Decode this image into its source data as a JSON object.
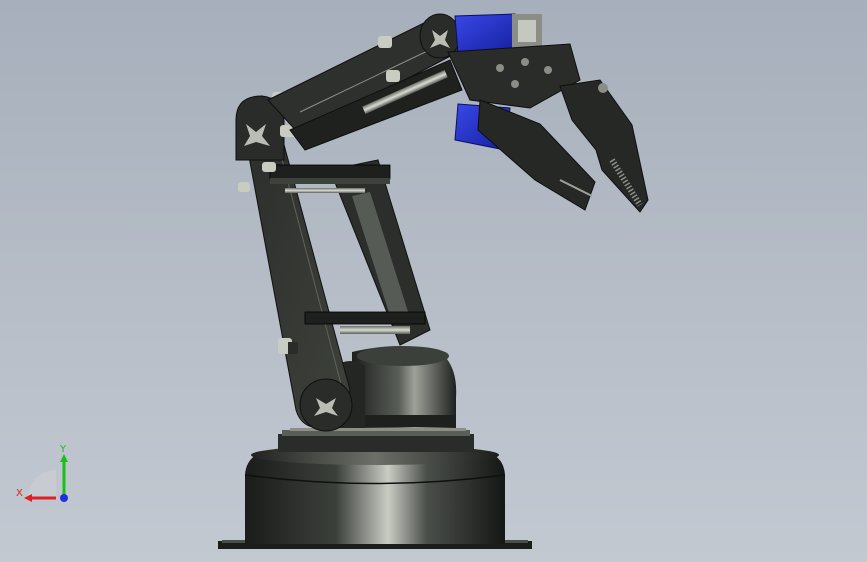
{
  "viewport": {
    "background_top": "#a6afbb",
    "background_bottom": "#c3c9d1"
  },
  "colors": {
    "metal_dark": "#1e201e",
    "metal_mid": "#3a3d39",
    "metal_light": "#6f746c",
    "servo_blue": "#2230c8",
    "axis_x": "#e02020",
    "axis_y": "#18c018",
    "axis_z": "#2030e0"
  },
  "triad": {
    "x_label": "X",
    "y_label": "Y"
  }
}
